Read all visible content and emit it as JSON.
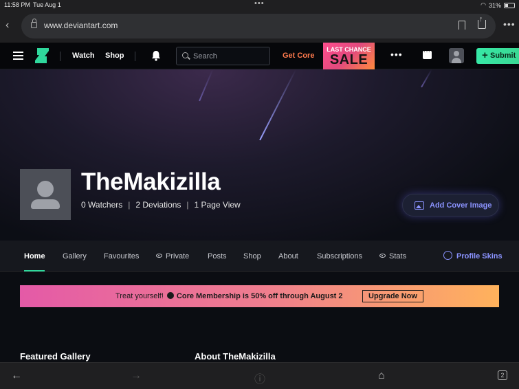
{
  "status_bar": {
    "time": "11:58 PM",
    "date": "Tue Aug 1",
    "battery": "31%"
  },
  "browser": {
    "url": "www.deviantart.com",
    "tab_count": "2"
  },
  "nav": {
    "watch": "Watch",
    "shop": "Shop",
    "search_placeholder": "Search",
    "get_core": "Get Core",
    "sale_top": "LAST CHANCE",
    "sale_bottom": "SALE",
    "submit": "Submit"
  },
  "profile": {
    "username": "TheMakizilla",
    "watchers": "0 Watchers",
    "deviations": "2 Deviations",
    "page_views": "1 Page View",
    "add_cover": "Add Cover Image"
  },
  "tabs": [
    {
      "label": "Home",
      "active": true
    },
    {
      "label": "Gallery"
    },
    {
      "label": "Favourites"
    },
    {
      "label": "Private"
    },
    {
      "label": "Posts"
    },
    {
      "label": "Shop"
    },
    {
      "label": "About"
    },
    {
      "label": "Subscriptions"
    },
    {
      "label": "Stats"
    }
  ],
  "profile_skins": "Profile Skins",
  "promo": {
    "lead": "Treat yourself!",
    "offer": "Core Membership is 50% off through August 2",
    "button": "Upgrade Now"
  },
  "sections": {
    "featured": "Featured Gallery",
    "about": "About TheMakizilla"
  },
  "colors": {
    "accent_green": "#2fd89c",
    "accent_purple": "#8b93ff",
    "get_core_orange": "#ff7a4d"
  }
}
